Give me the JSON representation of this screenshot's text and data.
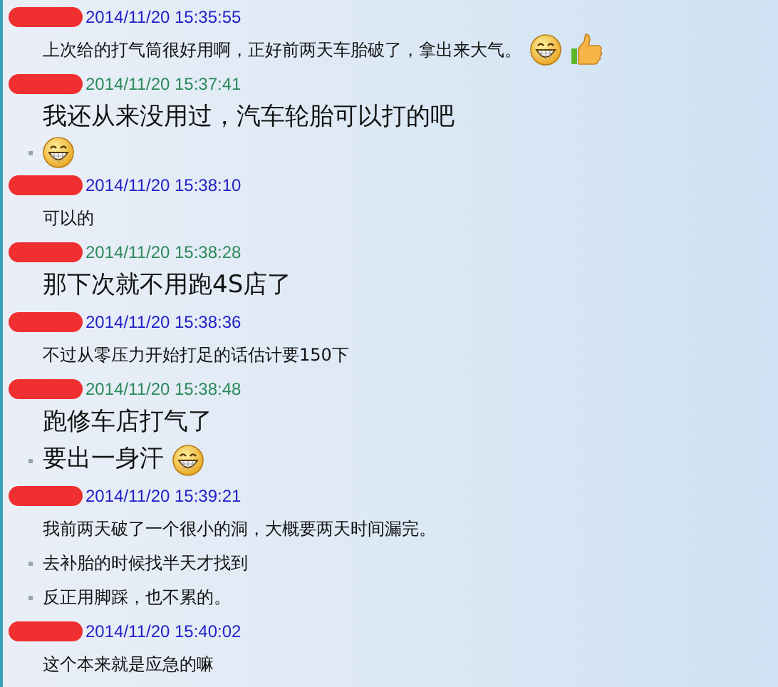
{
  "messages": [
    {
      "color": "#2020c8",
      "time": "2014/11/20 15:35:55",
      "lines": [
        {
          "kind": "small",
          "bullet": false,
          "parts": [
            {
              "kind": "text",
              "text": "上次给的打气筒很好用啊，正好前两天车胎破了，拿出来大气。"
            },
            {
              "kind": "grin"
            },
            {
              "kind": "thumbs-up"
            }
          ]
        }
      ]
    },
    {
      "color": "#2a8a5a",
      "time": "2014/11/20 15:37:41",
      "lines": [
        {
          "kind": "large",
          "bullet": false,
          "parts": [
            {
              "kind": "text",
              "text": "我还从来没用过，汽车轮胎可以打的吧"
            }
          ]
        },
        {
          "kind": "emoji",
          "bullet": true,
          "parts": [
            {
              "kind": "grin"
            }
          ]
        }
      ]
    },
    {
      "color": "#2020c8",
      "time": "2014/11/20 15:38:10",
      "lines": [
        {
          "kind": "small",
          "bullet": false,
          "parts": [
            {
              "kind": "text",
              "text": "可以的"
            }
          ]
        }
      ]
    },
    {
      "color": "#2a8a5a",
      "time": "2014/11/20 15:38:28",
      "lines": [
        {
          "kind": "large",
          "bullet": false,
          "parts": [
            {
              "kind": "text",
              "text": "那下次就不用跑4S店了"
            }
          ]
        }
      ]
    },
    {
      "color": "#2020c8",
      "time": "2014/11/20 15:38:36",
      "lines": [
        {
          "kind": "small",
          "bullet": false,
          "parts": [
            {
              "kind": "text",
              "text": "不过从零压力开始打足的话估计要150下"
            }
          ]
        }
      ]
    },
    {
      "color": "#2a8a5a",
      "time": "2014/11/20 15:38:48",
      "lines": [
        {
          "kind": "large",
          "bullet": false,
          "parts": [
            {
              "kind": "text",
              "text": "跑修车店打气了"
            }
          ]
        },
        {
          "kind": "large",
          "bullet": true,
          "parts": [
            {
              "kind": "text",
              "text": "要出一身汗"
            },
            {
              "kind": "grin"
            }
          ]
        }
      ]
    },
    {
      "color": "#2020c8",
      "time": "2014/11/20 15:39:21",
      "lines": [
        {
          "kind": "small",
          "bullet": false,
          "parts": [
            {
              "kind": "text",
              "text": "我前两天破了一个很小的洞，大概要两天时间漏完。"
            }
          ]
        },
        {
          "kind": "small",
          "bullet": true,
          "parts": [
            {
              "kind": "text",
              "text": "去补胎的时候找半天才找到"
            }
          ]
        },
        {
          "kind": "small",
          "bullet": true,
          "parts": [
            {
              "kind": "text",
              "text": "反正用脚踩，也不累的。"
            }
          ]
        }
      ]
    },
    {
      "color": "#2020c8",
      "time": "2014/11/20 15:40:02",
      "lines": [
        {
          "kind": "small",
          "bullet": false,
          "parts": [
            {
              "kind": "text",
              "text": "这个本来就是应急的嘛"
            }
          ]
        }
      ]
    }
  ]
}
